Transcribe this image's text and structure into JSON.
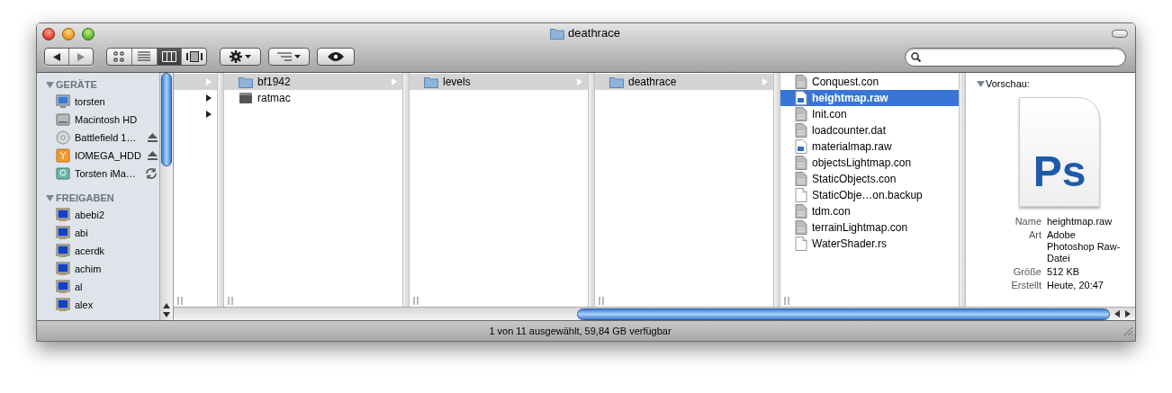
{
  "window": {
    "title": "deathrace"
  },
  "toolbar": {
    "view_modes": [
      {
        "kind": "icons",
        "selected": false
      },
      {
        "kind": "list",
        "selected": false
      },
      {
        "kind": "columns",
        "selected": true
      },
      {
        "kind": "coverflow",
        "selected": false
      }
    ]
  },
  "sidebar": {
    "sections": [
      {
        "title": "GERÄTE",
        "items": [
          {
            "label": "torsten",
            "kind": "computer"
          },
          {
            "label": "Macintosh HD",
            "kind": "harddisk"
          },
          {
            "label": "Battlefield 1…",
            "kind": "disc",
            "ejectable": true
          },
          {
            "label": "IOMEGA_HDD",
            "kind": "external",
            "ejectable": true
          },
          {
            "label": "Torsten iMa…",
            "kind": "backup",
            "syncing": true
          }
        ]
      },
      {
        "title": "FREIGABEN",
        "items": [
          {
            "label": "abebi2",
            "kind": "network"
          },
          {
            "label": "abi",
            "kind": "network"
          },
          {
            "label": "acerdk",
            "kind": "network"
          },
          {
            "label": "achim",
            "kind": "network"
          },
          {
            "label": "al",
            "kind": "network"
          },
          {
            "label": "alex",
            "kind": "network"
          }
        ]
      }
    ]
  },
  "columns": [
    {
      "focused": false,
      "items": [
        {
          "kind": "folder",
          "selected": true
        },
        {
          "kind": "folder",
          "selected": false
        },
        {
          "kind": "folder",
          "selected": false
        }
      ]
    },
    {
      "focused": false,
      "items": [
        {
          "label": "bf1942",
          "kind": "folder",
          "selected": true
        },
        {
          "label": "ratmac",
          "kind": "drive",
          "selected": false
        }
      ]
    },
    {
      "focused": false,
      "items": [
        {
          "label": "levels",
          "kind": "folder",
          "selected": true
        }
      ]
    },
    {
      "focused": false,
      "items": [
        {
          "label": "deathrace",
          "kind": "folder",
          "selected": true
        }
      ]
    },
    {
      "focused": true,
      "items": [
        {
          "label": "Conquest.con",
          "kind": "script",
          "selected": false
        },
        {
          "label": "heightmap.raw",
          "kind": "photoshop",
          "selected": true
        },
        {
          "label": "Init.con",
          "kind": "script",
          "selected": false
        },
        {
          "label": "loadcounter.dat",
          "kind": "script",
          "selected": false
        },
        {
          "label": "materialmap.raw",
          "kind": "photoshop",
          "selected": false
        },
        {
          "label": "objectsLightmap.con",
          "kind": "script",
          "selected": false
        },
        {
          "label": "StaticObjects.con",
          "kind": "script",
          "selected": false
        },
        {
          "label": "StaticObje…on.backup",
          "kind": "document",
          "selected": false
        },
        {
          "label": "tdm.con",
          "kind": "script",
          "selected": false
        },
        {
          "label": "terrainLightmap.con",
          "kind": "script",
          "selected": false
        },
        {
          "label": "WaterShader.rs",
          "kind": "document",
          "selected": false
        }
      ]
    }
  ],
  "preview": {
    "heading": "Vorschau:",
    "icon_label": "Ps",
    "info": [
      {
        "label": "Name",
        "value": "heightmap.raw"
      },
      {
        "label": "Art",
        "value": "Adobe Photoshop Raw-Datei"
      },
      {
        "label": "Größe",
        "value": "512 KB"
      },
      {
        "label": "Erstellt",
        "value": "Heute, 20:47"
      }
    ]
  },
  "status_bar": "1 von 11 ausgewählt, 59,84 GB verfügbar"
}
